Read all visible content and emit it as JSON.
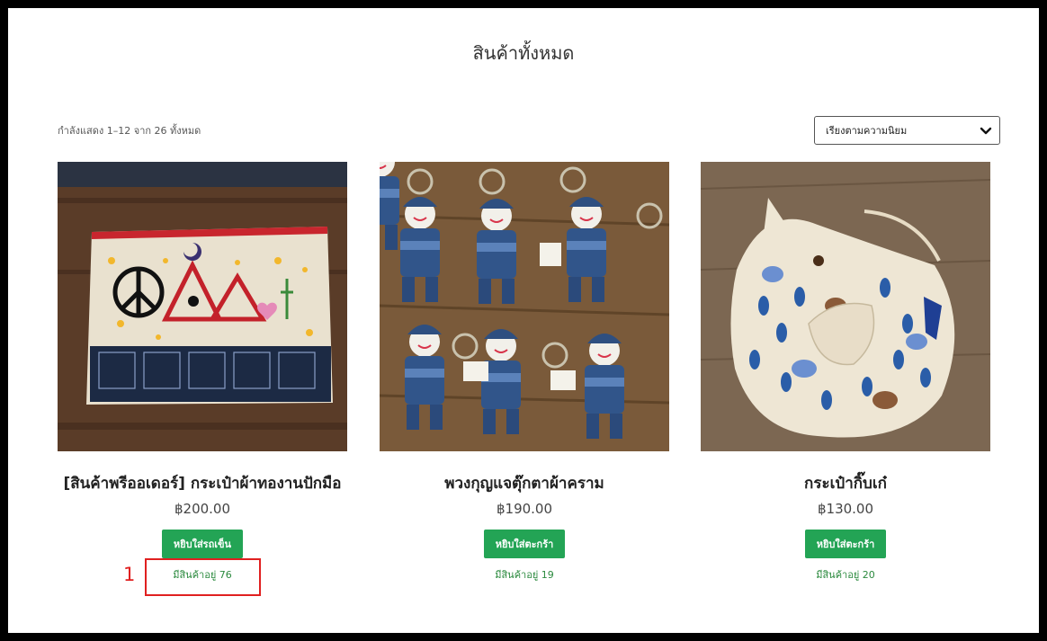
{
  "page": {
    "title": "สินค้าทั้งหมด",
    "result_count": "กำลังแสดง 1–12 จาก 26 ทั้งหมด",
    "sort": {
      "selected": "เรียงตามความนิยม",
      "icon": "chevron-down-icon"
    }
  },
  "products": [
    {
      "title": "[สินค้าพรีออเดอร์] กระเป๋าผ้าทองานปักมือ",
      "price": "฿200.00",
      "button": "หยิบใส่รถเข็น",
      "stock": "มีสินค้าอยู่ 76"
    },
    {
      "title": "พวงกุญแจตุ๊กตาผ้าคราม",
      "price": "฿190.00",
      "button": "หยิบใส่ตะกร้า",
      "stock": "มีสินค้าอยู่ 19"
    },
    {
      "title": "กระเป๋ากิ๊บเก๋",
      "price": "฿130.00",
      "button": "หยิบใส่ตะกร้า",
      "stock": "มีสินค้าอยู่ 20"
    }
  ],
  "annotation": {
    "label": "1",
    "color": "#e02020"
  },
  "colors": {
    "button": "#23a455",
    "stock_text": "#2b8a3e"
  }
}
